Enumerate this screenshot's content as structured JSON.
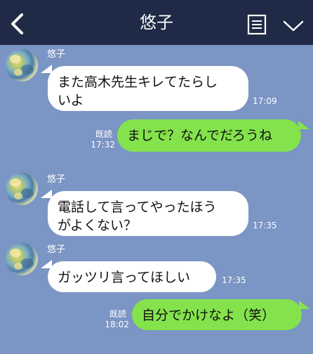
{
  "header": {
    "title": "悠子",
    "back_icon": "chevron-left-icon",
    "memo_icon": "memo-list-icon",
    "menu_icon": "chevron-down-icon"
  },
  "colors": {
    "header_bg": "#1f2a46",
    "chat_bg": "#7b95c4",
    "incoming_bubble": "#ffffff",
    "outgoing_bubble": "#84e34c"
  },
  "messages": [
    {
      "direction": "incoming",
      "sender": "悠子",
      "lines": [
        "また高木先生キレてたらし",
        "いよ"
      ],
      "time": "17:09"
    },
    {
      "direction": "outgoing",
      "text": "まじで？なんでだろうね",
      "read": "既読",
      "time": "17:32"
    },
    {
      "direction": "incoming",
      "sender": "悠子",
      "lines": [
        "電話して言ってやったほう",
        "がよくない？"
      ],
      "time": "17:35"
    },
    {
      "direction": "incoming",
      "sender": "悠子",
      "text": "ガッツリ言ってほしい",
      "time": "17:35"
    },
    {
      "direction": "outgoing",
      "text": "自分でかけなよ（笑）",
      "read": "既読",
      "time": "18:02"
    }
  ]
}
